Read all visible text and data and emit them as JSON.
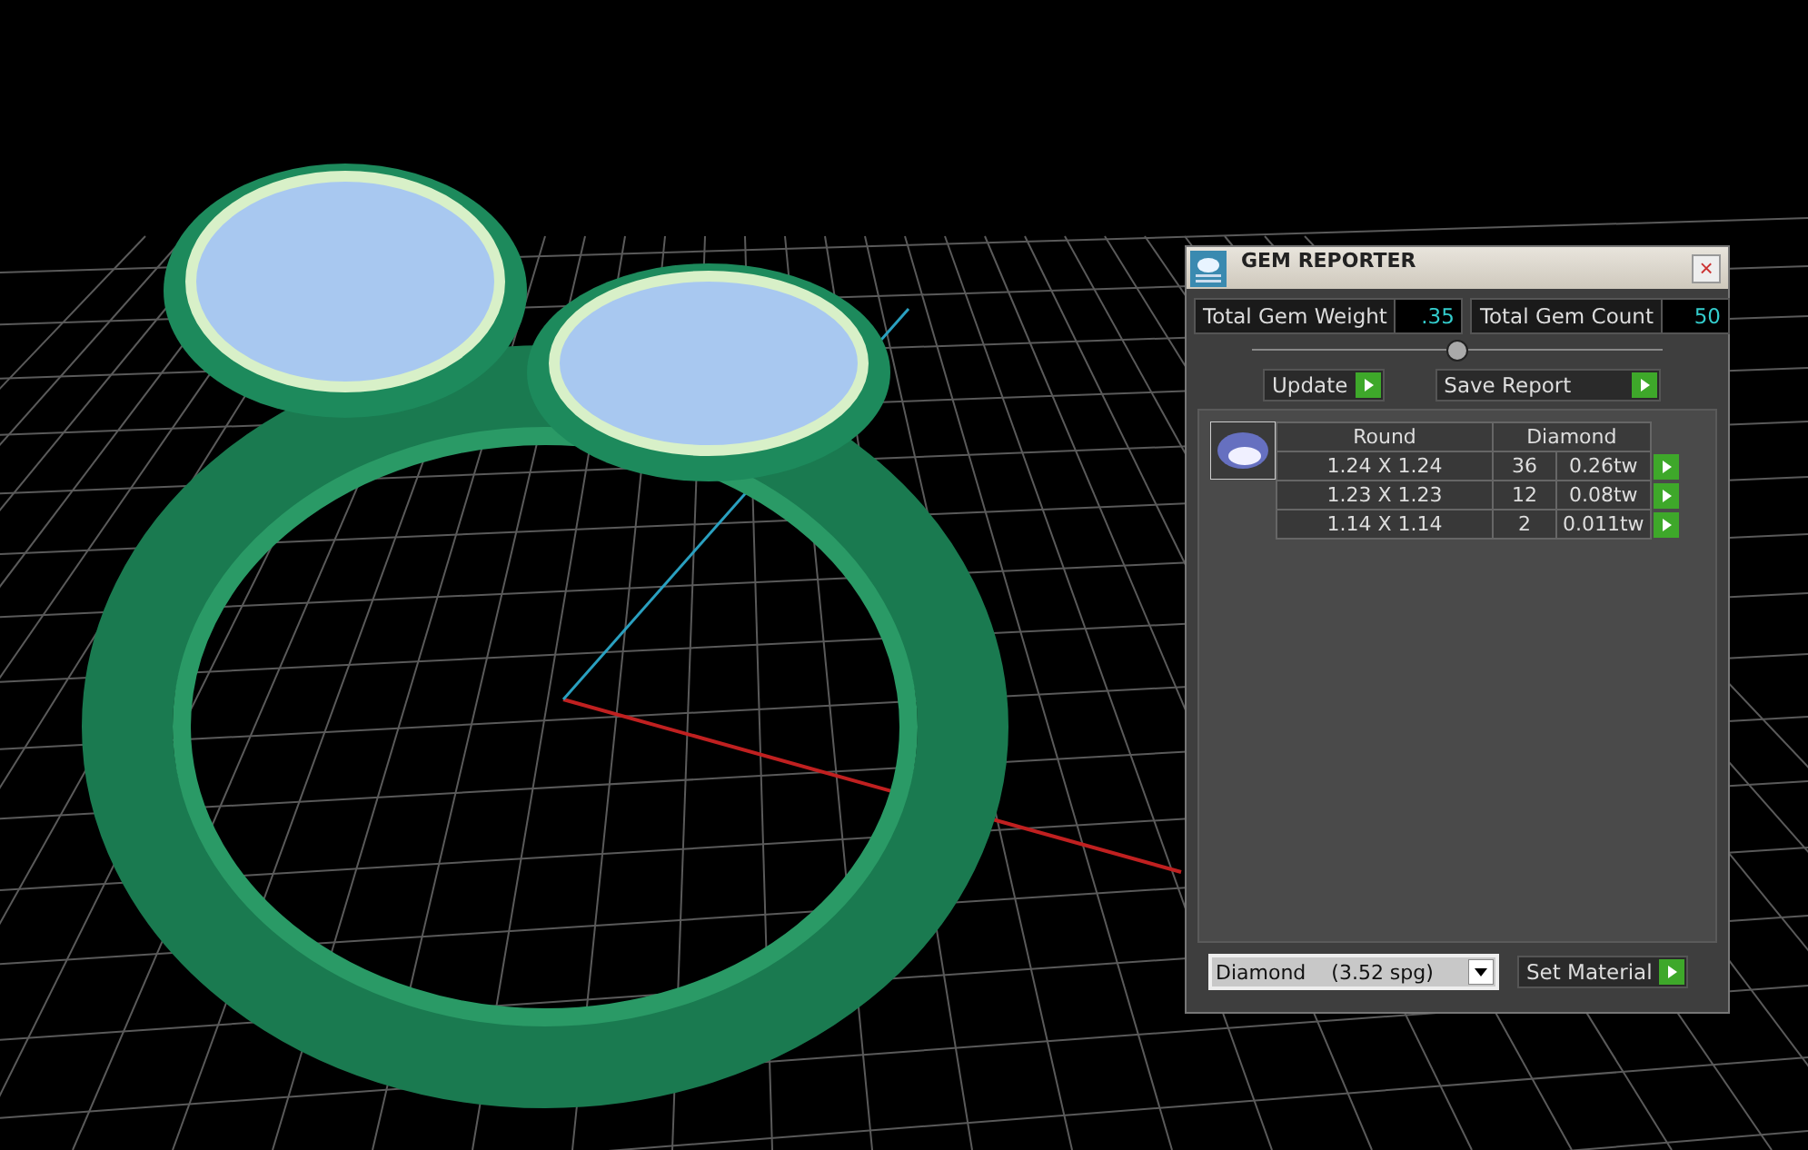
{
  "panel": {
    "title": "GEM REPORTER",
    "close": "×"
  },
  "totals": [
    {
      "label": "Total Gem Weight",
      "value": ".35"
    },
    {
      "label": "Total Gem Count",
      "value": "50"
    }
  ],
  "slider": {
    "level": 0.5
  },
  "actions": [
    {
      "label": "Update"
    },
    {
      "label": "Save Report"
    }
  ],
  "table": {
    "columns": [
      "Round",
      "Diamond"
    ],
    "rows": [
      {
        "size": "1.24 X 1.24",
        "count": "36",
        "weight": "0.26tw"
      },
      {
        "size": "1.23 X 1.23",
        "count": "12",
        "weight": "0.08tw"
      },
      {
        "size": "1.14 X 1.14",
        "count": "2",
        "weight": "0.011tw"
      }
    ]
  },
  "material": {
    "value": "Diamond    (3.52 spg)",
    "button": "Set Material"
  }
}
